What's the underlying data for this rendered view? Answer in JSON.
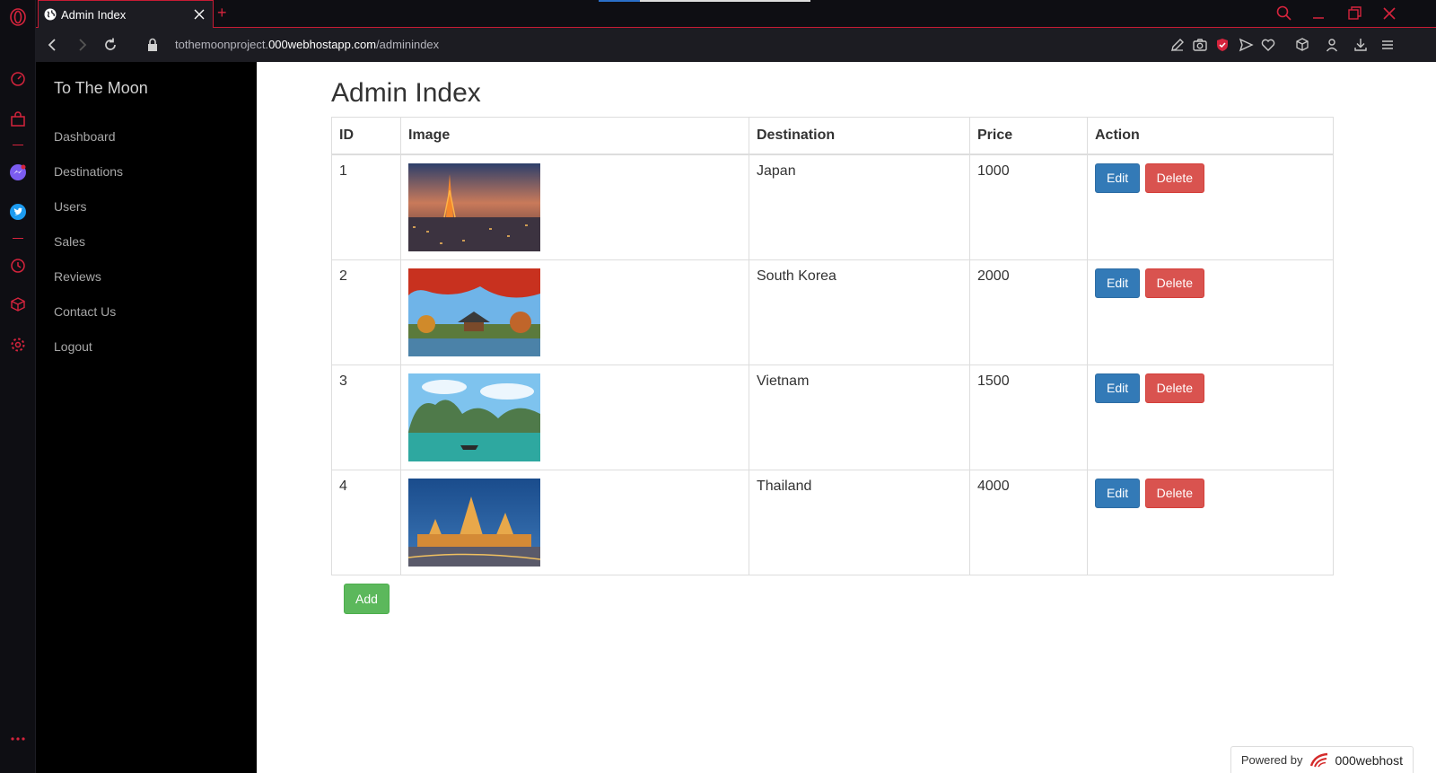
{
  "browser": {
    "tab_title": "Admin Index",
    "url_prefix": "tothemoonproject.",
    "url_host": "000webhostapp.com",
    "url_path": "/adminindex",
    "accent_color": "#d6243d"
  },
  "sidebar": {
    "brand": "To The Moon",
    "items": [
      {
        "label": "Dashboard"
      },
      {
        "label": "Destinations"
      },
      {
        "label": "Users"
      },
      {
        "label": "Sales"
      },
      {
        "label": "Reviews"
      },
      {
        "label": "Contact Us"
      },
      {
        "label": "Logout"
      }
    ]
  },
  "main": {
    "title": "Admin Index",
    "columns": [
      "ID",
      "Image",
      "Destination",
      "Price",
      "Action"
    ],
    "rows": [
      {
        "id": "1",
        "destination": "Japan",
        "price": "1000",
        "image": "tokyo-tower-dusk"
      },
      {
        "id": "2",
        "destination": "South Korea",
        "price": "2000",
        "image": "korean-palace-autumn"
      },
      {
        "id": "3",
        "destination": "Vietnam",
        "price": "1500",
        "image": "ha-long-bay"
      },
      {
        "id": "4",
        "destination": "Thailand",
        "price": "4000",
        "image": "bangkok-grand-palace"
      }
    ],
    "edit_label": "Edit",
    "delete_label": "Delete",
    "add_label": "Add"
  },
  "footer": {
    "powered_by": "Powered by",
    "brand": "000webhost"
  },
  "colors": {
    "edit": "#337ab7",
    "delete": "#d9534f",
    "add": "#5cb85c"
  }
}
